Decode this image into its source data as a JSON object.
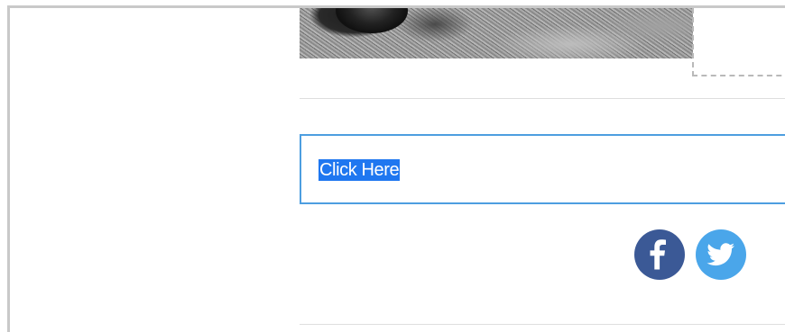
{
  "email_editor": {
    "button": {
      "label": "Click Here",
      "text_selected": true
    },
    "social": {
      "icons": [
        "facebook-icon",
        "twitter-icon"
      ],
      "colors": {
        "facebook": "#3b5996",
        "twitter": "#4aa6ea"
      }
    },
    "accents": {
      "selection_border": "#4d9ee0",
      "text_highlight": "#1f77f0"
    }
  }
}
